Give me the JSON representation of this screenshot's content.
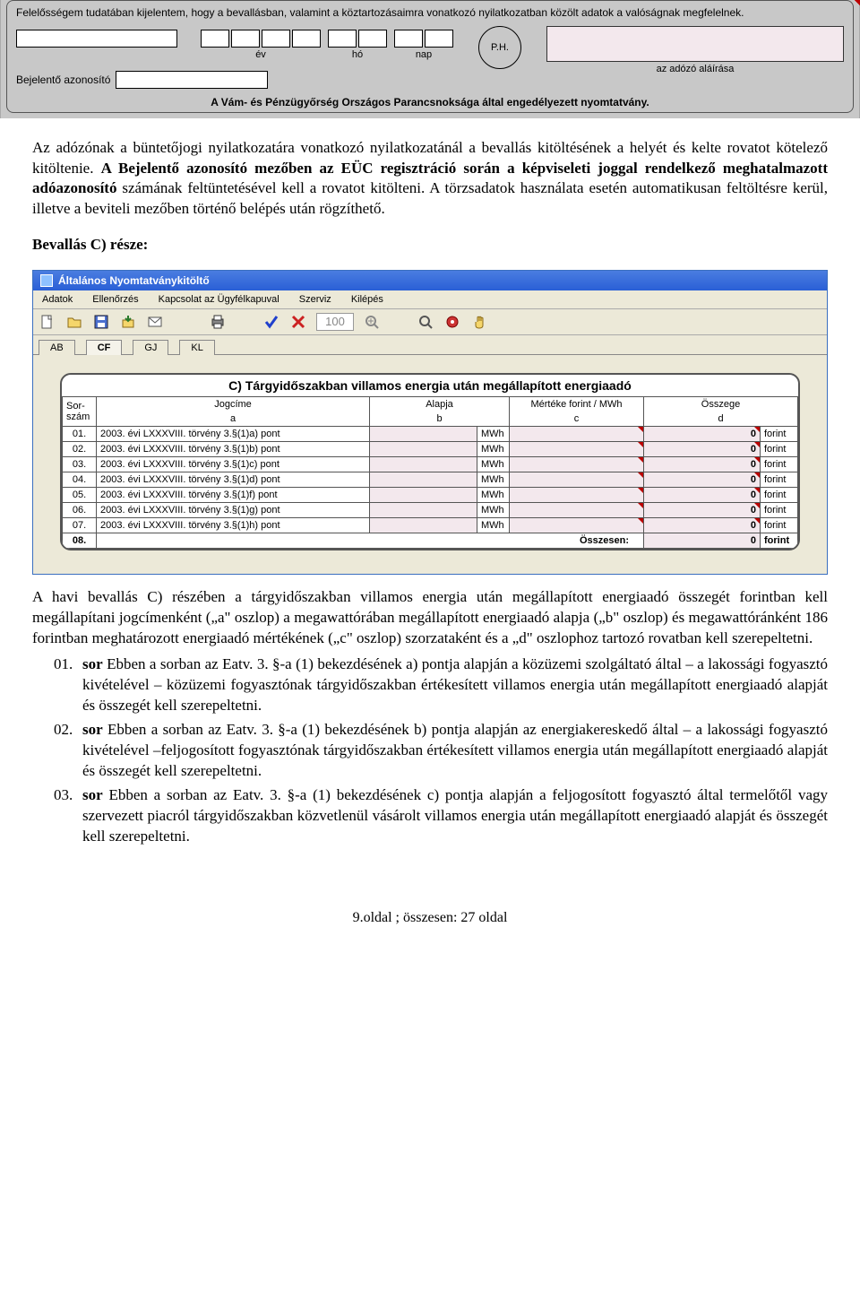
{
  "form": {
    "declaration": "Felelősségem tudatában kijelentem, hogy a bevallásban, valamint a köztartozásaimra vonatkozó nyilatkozatban közölt adatok a valóságnak megfelelnek.",
    "ev": "év",
    "ho": "hó",
    "nap": "nap",
    "ph": "P.H.",
    "sign": "az adózó aláírása",
    "bejelento": "Bejelentő azonosító",
    "footer": "A Vám- és Pénzügyőrség Országos Parancsnoksága által engedélyezett nyomtatvány."
  },
  "body": {
    "p1a": "Az adózónak a büntetőjogi nyilatkozatára vonatkozó nyilatkozatánál a bevallás kitöltésének a helyét és kelte rovatot kötelező kitöltenie. ",
    "p1b": "A Bejelentő azonosító mezőben az EÜC regisztráció során a képviseleti joggal rendelkező meghatalmazott ",
    "p1c": "adóazonosító",
    "p1d": " számának feltüntetésével kell a rovatot kitölteni. A törzsadatok használata esetén automatikusan feltöltésre kerül, illetve a beviteli mezőben történő belépés után rögzíthető.",
    "section": "Bevallás C) része:"
  },
  "app": {
    "title": "Általános Nyomtatványkitöltő",
    "menu": [
      "Adatok",
      "Ellenőrzés",
      "Kapcsolat az Ügyfélkapuval",
      "Szerviz",
      "Kilépés"
    ],
    "zoom": "100",
    "tabs": [
      "AB",
      "CF",
      "GJ",
      "KL"
    ],
    "active_tab": 1,
    "panel_title": "C) Tárgyidőszakban villamos energia után megállapított energiaadó",
    "headers": {
      "sor": "Sor-\nszám",
      "jog": "Jogcíme",
      "al": "Alapja",
      "mer": "Mértéke forint / MWh",
      "ossz": "Összege",
      "a": "a",
      "b": "b",
      "c": "c",
      "d": "d"
    },
    "unit": "MWh",
    "funit": "forint",
    "rows": [
      {
        "n": "01",
        "j": "2003. évi LXXXVIII. törvény 3.§(1)a) pont",
        "o": "0"
      },
      {
        "n": "02",
        "j": "2003. évi LXXXVIII. törvény 3.§(1)b) pont",
        "o": "0"
      },
      {
        "n": "03",
        "j": "2003. évi LXXXVIII. törvény 3.§(1)c) pont",
        "o": "0"
      },
      {
        "n": "04",
        "j": "2003. évi LXXXVIII. törvény 3.§(1)d) pont",
        "o": "0"
      },
      {
        "n": "05",
        "j": "2003. évi LXXXVIII. törvény 3.§(1)f) pont",
        "o": "0"
      },
      {
        "n": "06",
        "j": "2003. évi LXXXVIII. törvény 3.§(1)g) pont",
        "o": "0"
      },
      {
        "n": "07",
        "j": "2003. évi LXXXVIII. törvény 3.§(1)h) pont",
        "o": "0"
      }
    ],
    "sum": {
      "n": "08",
      "label": "Összesen:",
      "o": "0"
    }
  },
  "after": {
    "p2": "A havi bevallás C) részében a tárgyidőszakban villamos energia után megállapított energiaadó összegét forintban kell megállapítani jogcímenként („a\" oszlop) a megawattórában megállapított energiaadó alapja („b\" oszlop) és megawattóránként 186 forintban meghatározott energiaadó mértékének („c\" oszlop) szorzataként és a „d\" oszlophoz tartozó rovatban kell szerepeltetni.",
    "items": [
      {
        "n": "01.",
        "bold": "sor",
        "t": " Ebben a sorban az Eatv. 3. §-a (1) bekezdésének a) pontja alapján a közüzemi szolgáltató által – a lakossági fogyasztó kivételével – közüzemi fogyasztónak tárgyidőszakban értékesített villamos energia után megállapított energiaadó alapját és összegét kell szerepeltetni."
      },
      {
        "n": "02.",
        "bold": "sor",
        "t": " Ebben a sorban az Eatv. 3. §-a (1) bekezdésének b) pontja alapján az energiakereskedő által – a lakossági fogyasztó kivételével –feljogosított fogyasztónak tárgyidőszakban értékesített villamos energia után megállapított energiaadó alapját és összegét kell szerepeltetni."
      },
      {
        "n": "03.",
        "bold": "sor",
        "t": " Ebben a sorban az Eatv. 3. §-a (1) bekezdésének c) pontja alapján a feljogosított fogyasztó által termelőtől vagy szervezett piacról tárgyidőszakban közvetlenül vásárolt villamos energia után megállapított energiaadó alapját és összegét kell szerepeltetni."
      }
    ]
  },
  "footer": "9.oldal ; összesen: 27 oldal"
}
